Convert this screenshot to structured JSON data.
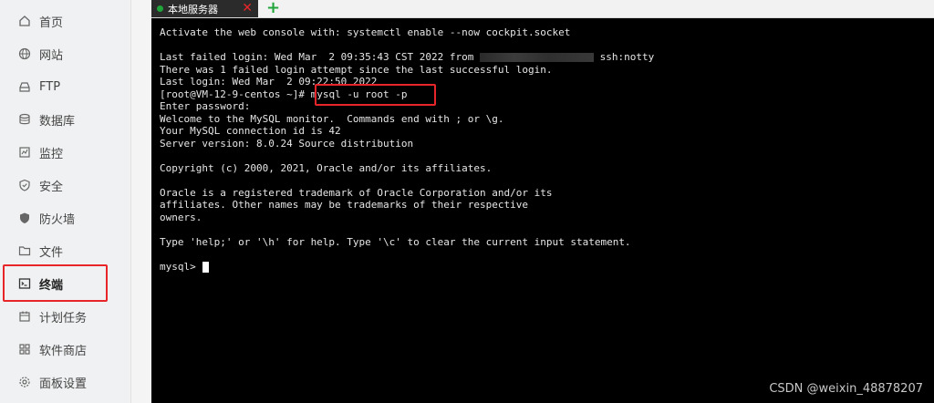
{
  "sidebar": {
    "items": [
      {
        "label": "首页",
        "icon": "home-icon"
      },
      {
        "label": "网站",
        "icon": "globe-icon"
      },
      {
        "label": "FTP",
        "icon": "ftp-icon"
      },
      {
        "label": "数据库",
        "icon": "database-icon"
      },
      {
        "label": "监控",
        "icon": "monitor-icon"
      },
      {
        "label": "安全",
        "icon": "shield-icon"
      },
      {
        "label": "防火墙",
        "icon": "firewall-icon"
      },
      {
        "label": "文件",
        "icon": "folder-icon"
      },
      {
        "label": "终端",
        "icon": "terminal-icon",
        "active": true
      },
      {
        "label": "计划任务",
        "icon": "calendar-icon"
      },
      {
        "label": "软件商店",
        "icon": "apps-icon"
      },
      {
        "label": "面板设置",
        "icon": "gear-icon"
      }
    ]
  },
  "tabs": {
    "active_label": "本地服务器",
    "close_symbol": "✕",
    "add_symbol": "+"
  },
  "terminal": {
    "line1": "Activate the web console with: systemctl enable --now cockpit.socket",
    "line2_pre": "Last failed login: Wed Mar  2 09:35:43 CST 2022 from ",
    "line2_post": " ssh:notty",
    "line3": "There was 1 failed login attempt since the last successful login.",
    "line4": "Last login: Wed Mar  2 09:22:50 2022",
    "prompt": "[root@VM-12-9-centos ~]# ",
    "command": "mysql -u root -p",
    "line6": "Enter password:",
    "line7": "Welcome to the MySQL monitor.  Commands end with ; or \\g.",
    "line8": "Your MySQL connection id is 42",
    "line9": "Server version: 8.0.24 Source distribution",
    "line10": "Copyright (c) 2000, 2021, Oracle and/or its affiliates.",
    "line11": "Oracle is a registered trademark of Oracle Corporation and/or its",
    "line12": "affiliates. Other names may be trademarks of their respective",
    "line13": "owners.",
    "line14": "Type 'help;' or '\\h' for help. Type '\\c' to clear the current input statement.",
    "mysql_prompt": "mysql> "
  },
  "watermark": "CSDN @weixin_48878207",
  "colors": {
    "highlight": "#e8262a",
    "accent": "#20a53a",
    "terminal_bg": "#000000"
  }
}
